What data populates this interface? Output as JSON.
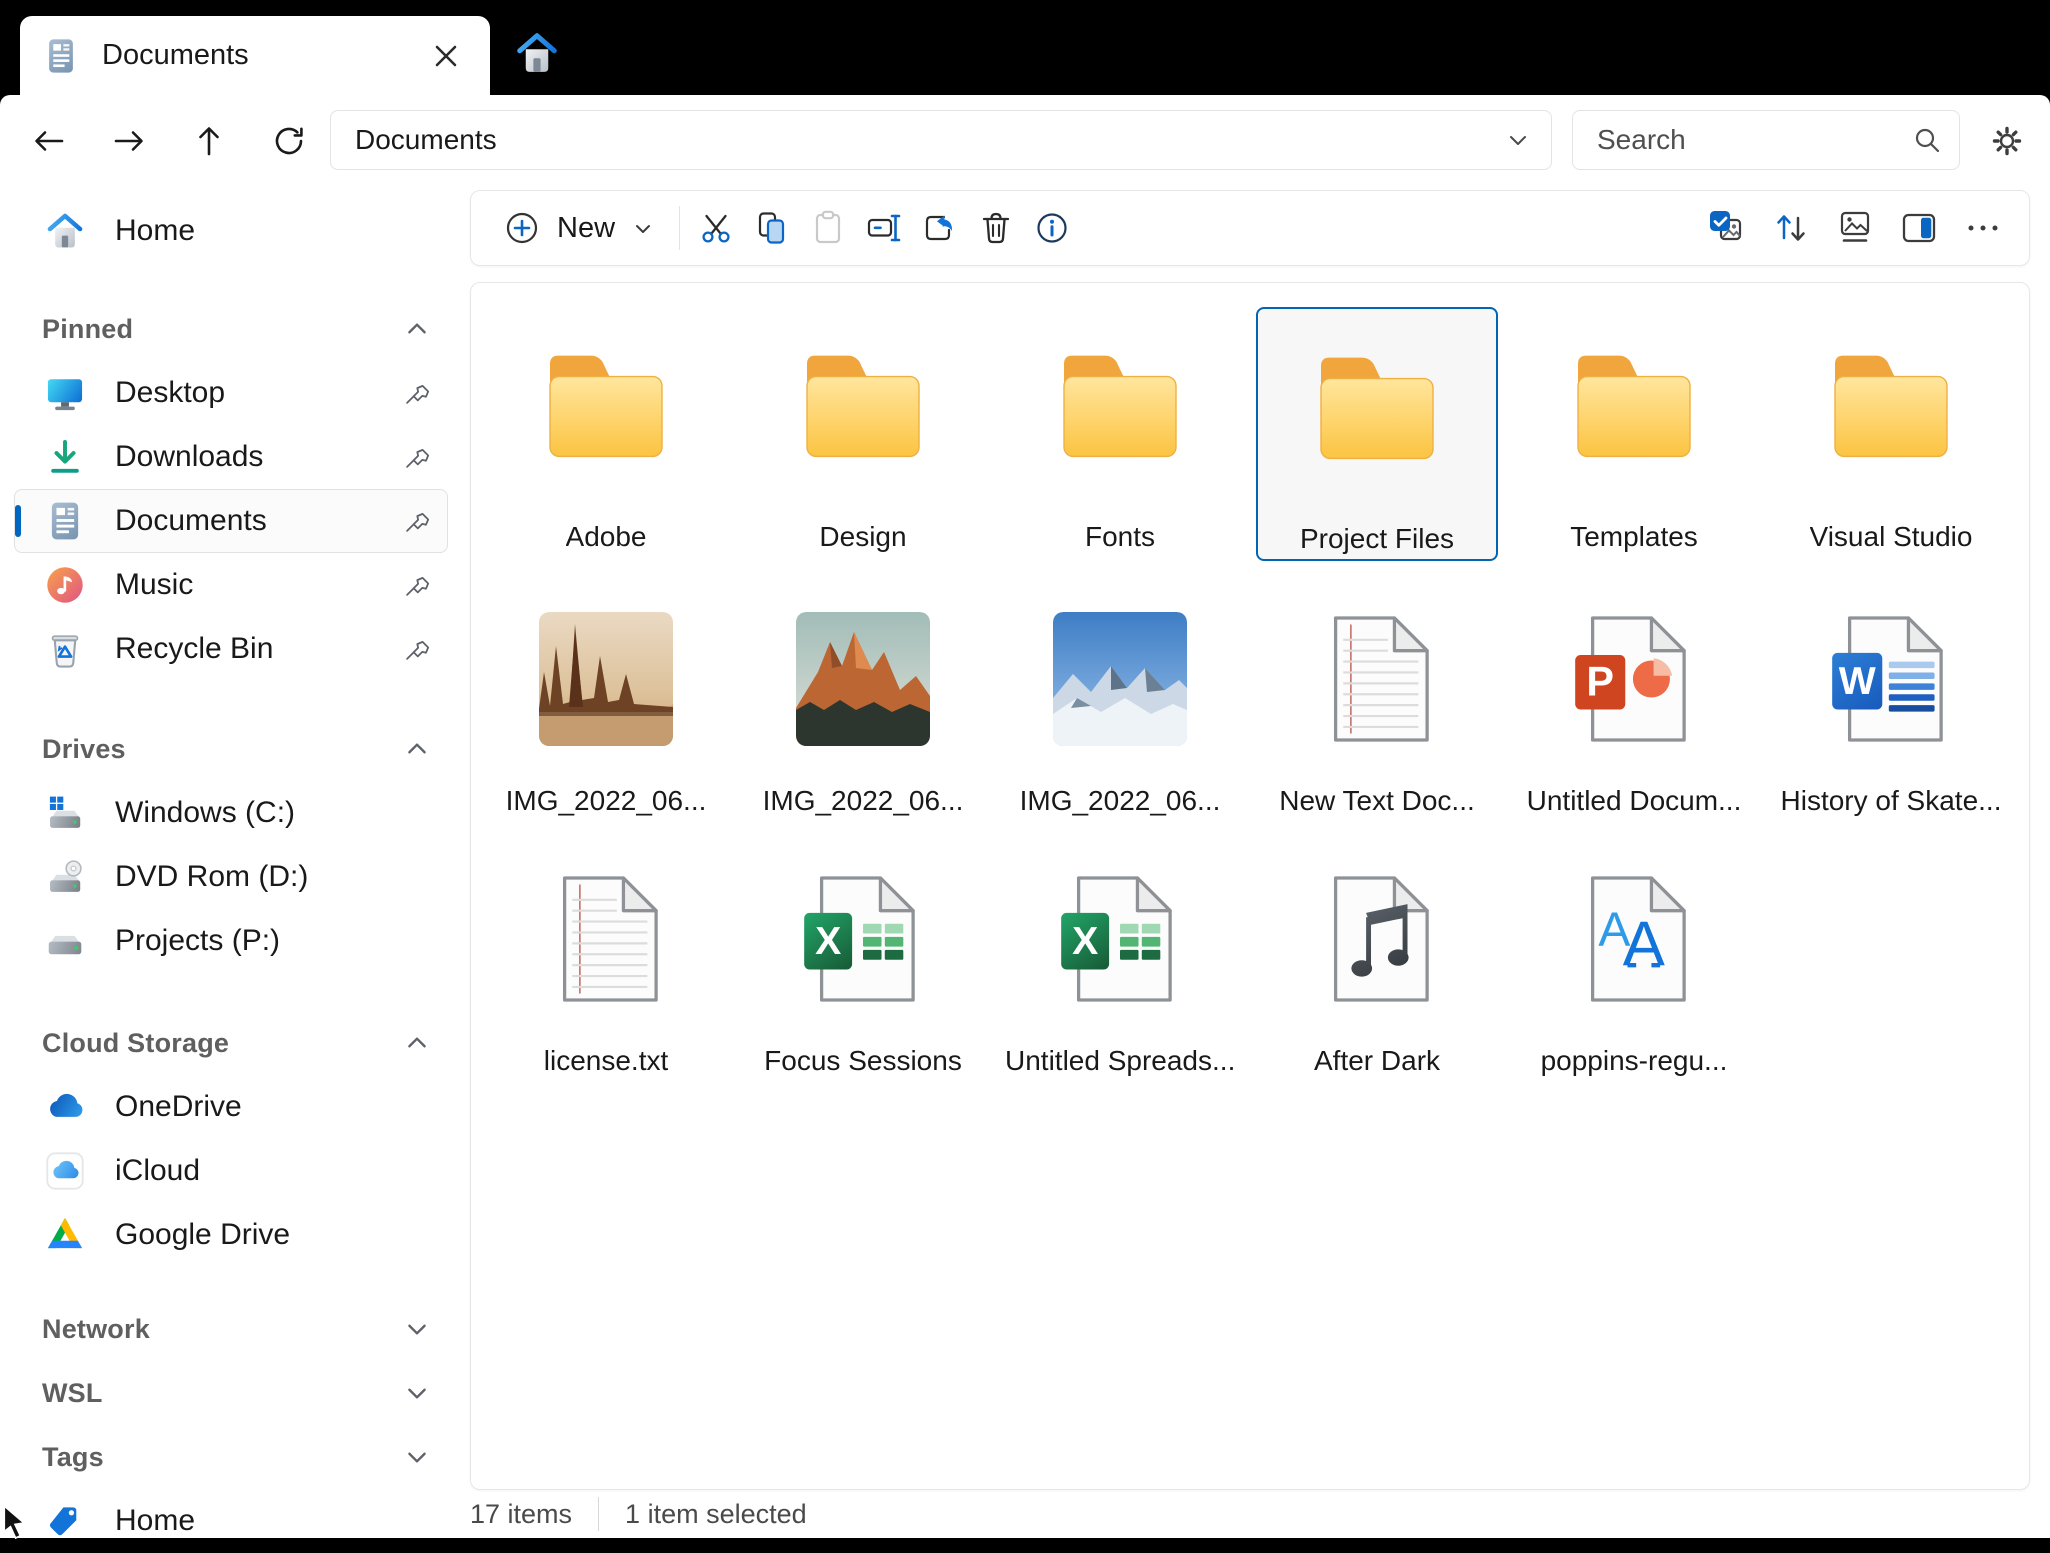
{
  "titlebar": {
    "tab_title": "Documents",
    "close_glyph": "✕",
    "icons": [
      "documents-icon",
      "home-icon"
    ]
  },
  "navbar": {
    "address": "Documents",
    "search_placeholder": "Search",
    "nav_icons": [
      "back-icon",
      "forward-icon",
      "up-icon",
      "refresh-icon"
    ],
    "right_icons": [
      "search-icon",
      "gear-icon"
    ]
  },
  "toolbar": {
    "new_label": "New",
    "buttons": [
      {
        "name": "cut",
        "enabled": true
      },
      {
        "name": "copy",
        "enabled": true
      },
      {
        "name": "paste",
        "enabled": false
      },
      {
        "name": "rename",
        "enabled": true
      },
      {
        "name": "share",
        "enabled": true
      },
      {
        "name": "delete",
        "enabled": true
      },
      {
        "name": "info",
        "enabled": true
      }
    ],
    "right_buttons": [
      "select-all",
      "sort",
      "view",
      "details-pane",
      "more"
    ]
  },
  "sidebar": {
    "top": {
      "label": "Home",
      "icon": "home"
    },
    "sections": [
      {
        "label": "Pinned",
        "chevron": "up",
        "items": [
          {
            "label": "Desktop",
            "icon": "desktop",
            "pinned": true
          },
          {
            "label": "Downloads",
            "icon": "downloads",
            "pinned": true
          },
          {
            "label": "Documents",
            "icon": "documents",
            "pinned": true,
            "selected": true
          },
          {
            "label": "Music",
            "icon": "music",
            "pinned": true
          },
          {
            "label": "Recycle Bin",
            "icon": "recycle-bin",
            "pinned": true
          }
        ]
      },
      {
        "label": "Drives",
        "chevron": "up",
        "items": [
          {
            "label": "Windows (C:)",
            "icon": "drive-windows"
          },
          {
            "label": "DVD Rom (D:)",
            "icon": "drive-dvd"
          },
          {
            "label": "Projects (P:)",
            "icon": "drive"
          }
        ]
      },
      {
        "label": "Cloud Storage",
        "chevron": "up",
        "items": [
          {
            "label": "OneDrive",
            "icon": "onedrive"
          },
          {
            "label": "iCloud",
            "icon": "icloud"
          },
          {
            "label": "Google Drive",
            "icon": "google-drive"
          }
        ]
      },
      {
        "label": "Network",
        "chevron": "down",
        "items": []
      },
      {
        "label": "WSL",
        "chevron": "down",
        "items": []
      },
      {
        "label": "Tags",
        "chevron": "down",
        "items": [
          {
            "label": "Home",
            "icon": "tag"
          }
        ]
      }
    ]
  },
  "files": [
    {
      "label": "Adobe",
      "type": "folder"
    },
    {
      "label": "Design",
      "type": "folder"
    },
    {
      "label": "Fonts",
      "type": "folder"
    },
    {
      "label": "Project Files",
      "type": "folder",
      "selected": true
    },
    {
      "label": "Templates",
      "type": "folder"
    },
    {
      "label": "Visual Studio",
      "type": "folder"
    },
    {
      "label": "IMG_2022_06...",
      "type": "image-desert"
    },
    {
      "label": "IMG_2022_06...",
      "type": "image-alpine"
    },
    {
      "label": "IMG_2022_06...",
      "type": "image-snow"
    },
    {
      "label": "New Text Doc...",
      "type": "text"
    },
    {
      "label": "Untitled Docum...",
      "type": "powerpoint"
    },
    {
      "label": "History of Skate...",
      "type": "word"
    },
    {
      "label": "license.txt",
      "type": "text"
    },
    {
      "label": "Focus Sessions",
      "type": "excel"
    },
    {
      "label": "Untitled Spreads...",
      "type": "excel"
    },
    {
      "label": "After Dark",
      "type": "music"
    },
    {
      "label": "poppins-regu...",
      "type": "font"
    }
  ],
  "statusbar": {
    "count": "17 items",
    "selection": "1 item selected"
  },
  "colors": {
    "accent": "#0067c0",
    "selection_border": "#0066b4",
    "titlebar": "#000000",
    "folder_yellow": "#fcc343",
    "word_blue": "#185abd",
    "excel_green": "#1e7346",
    "powerpoint_red": "#cf4520"
  }
}
